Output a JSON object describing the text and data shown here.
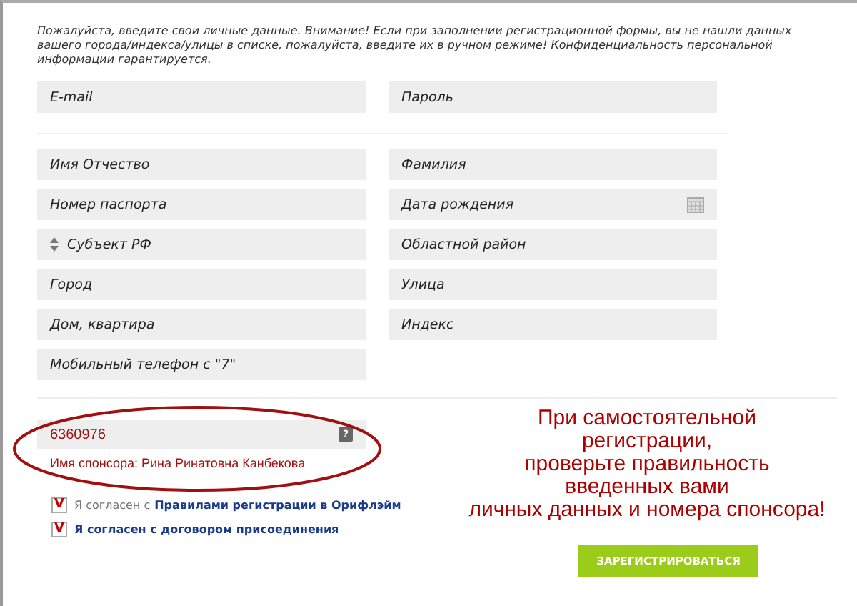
{
  "intro": "Пожалуйста, введите свои личные данные. Внимание! Если при заполнении регистрационной формы, вы не нашли данных вашего города/индекса/улицы в списке, пожалуйста, введите их в ручном режиме! Конфиденциальность персональной информации гарантируется.",
  "account_fields": [
    {
      "placeholder": "E-mail"
    },
    {
      "placeholder": "Пароль"
    }
  ],
  "personal_fields": [
    {
      "placeholder": "Имя Отчество",
      "kind": "text"
    },
    {
      "placeholder": "Фамилия",
      "kind": "text"
    },
    {
      "placeholder": "Номер паспорта",
      "kind": "text"
    },
    {
      "placeholder": "Дата рождения",
      "kind": "date"
    },
    {
      "placeholder": "Субъект РФ",
      "kind": "select"
    },
    {
      "placeholder": "Областной район",
      "kind": "text"
    },
    {
      "placeholder": "Город",
      "kind": "text"
    },
    {
      "placeholder": "Улица",
      "kind": "text"
    },
    {
      "placeholder": "Дом, квартира",
      "kind": "text"
    },
    {
      "placeholder": "Индекс",
      "kind": "text"
    },
    {
      "placeholder": "Мобильный телефон с \"7\"",
      "kind": "text"
    }
  ],
  "sponsor": {
    "value": "6360976",
    "help": "?",
    "name": "Имя спонсора: Рина Ринатовна Канбекова"
  },
  "agreements": [
    {
      "mark": "V",
      "checked": true,
      "text": "Я согласен с ",
      "link": "Правилами регистрации в Орифлэйм"
    },
    {
      "mark": "V",
      "checked": true,
      "link": "Я согласен с договором присоединения"
    }
  ],
  "callout_lines": [
    "При самостоятельной",
    "регистрации,",
    "проверьте правильность",
    "введенных вами",
    "личных данных и номера спонсора!"
  ],
  "submit": "ЗАРЕГИСТРИРОВАТЬСЯ"
}
